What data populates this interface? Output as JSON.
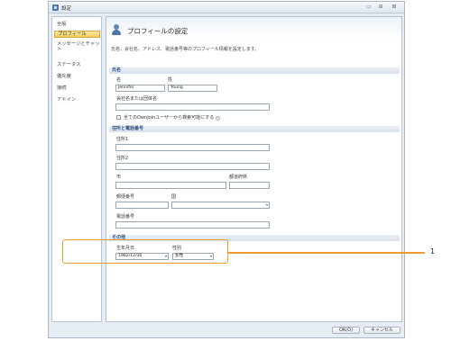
{
  "window": {
    "title": "設定",
    "minimize": "▭",
    "maximize": "⊞",
    "close": "⊠"
  },
  "sidebar": {
    "items": [
      {
        "label": "全般"
      },
      {
        "label": "プロフィール",
        "active": true
      },
      {
        "label": "メッセージとチャット"
      },
      {
        "label": "ステータス"
      },
      {
        "label": "優先度"
      },
      {
        "label": "接続"
      },
      {
        "label": "アドイン"
      }
    ]
  },
  "page": {
    "title": "プロフィールの設定",
    "description": "氏名、会社名、アドレス、電話番号等のプロフィール情報を設定します。"
  },
  "sections": {
    "name": "氏名",
    "address": "住所と電話番号",
    "other": "その他"
  },
  "fields": {
    "first_name_label": "名",
    "first_name_value": "Jennifer",
    "last_name_label": "姓",
    "last_name_value": "Young",
    "company_label": "会社名または団体名",
    "company_value": "",
    "searchable_label": "全てのOwnJoinユーザーから検索可能にする",
    "address1_label": "住所1",
    "address2_label": "住所2",
    "city_label": "市",
    "prefecture_label": "都道府県",
    "postal_label": "郵便番号",
    "country_label": "国",
    "phone_label": "電話番号",
    "birthdate_label": "生年月日",
    "birthdate_value": "1982/12/30",
    "gender_label": "性別",
    "gender_value": "女性"
  },
  "footer": {
    "ok_label": "OK(O)",
    "cancel_label": "キャンセル"
  },
  "callout": {
    "number": "1"
  },
  "colors": {
    "accent": "#f29a2e",
    "section_text": "#2a4f80",
    "active_item": "#f3cf5b"
  }
}
